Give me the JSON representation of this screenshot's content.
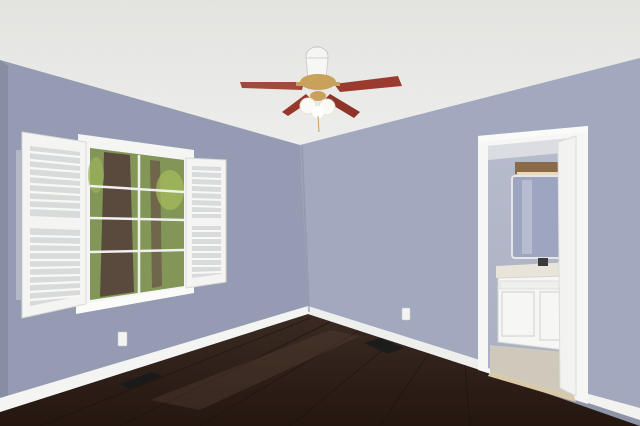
{
  "scene": {
    "kind": "interior-photo",
    "colors": {
      "ceiling": "#e9e9e7",
      "wall_left": "#959bb2",
      "wall_back": "#a3a9bf",
      "wall_right": "#9ea4bb",
      "trim": "#f4f4f2",
      "floor": "#2e1f1a",
      "floor_highlight": "#4a362e",
      "fan_blade": "#9b3b2f",
      "fan_brass": "#c8a15a",
      "vanity": "#f6f6f4",
      "tree_green": "#7f9a45"
    },
    "objects": [
      "textured-ceiling",
      "ceiling-fan",
      "double-hung-window",
      "plantation-shutters",
      "bathroom-doorway",
      "vanity-cabinet",
      "mirror",
      "hardwood-floor",
      "floor-vents",
      "electrical-outlets"
    ]
  }
}
